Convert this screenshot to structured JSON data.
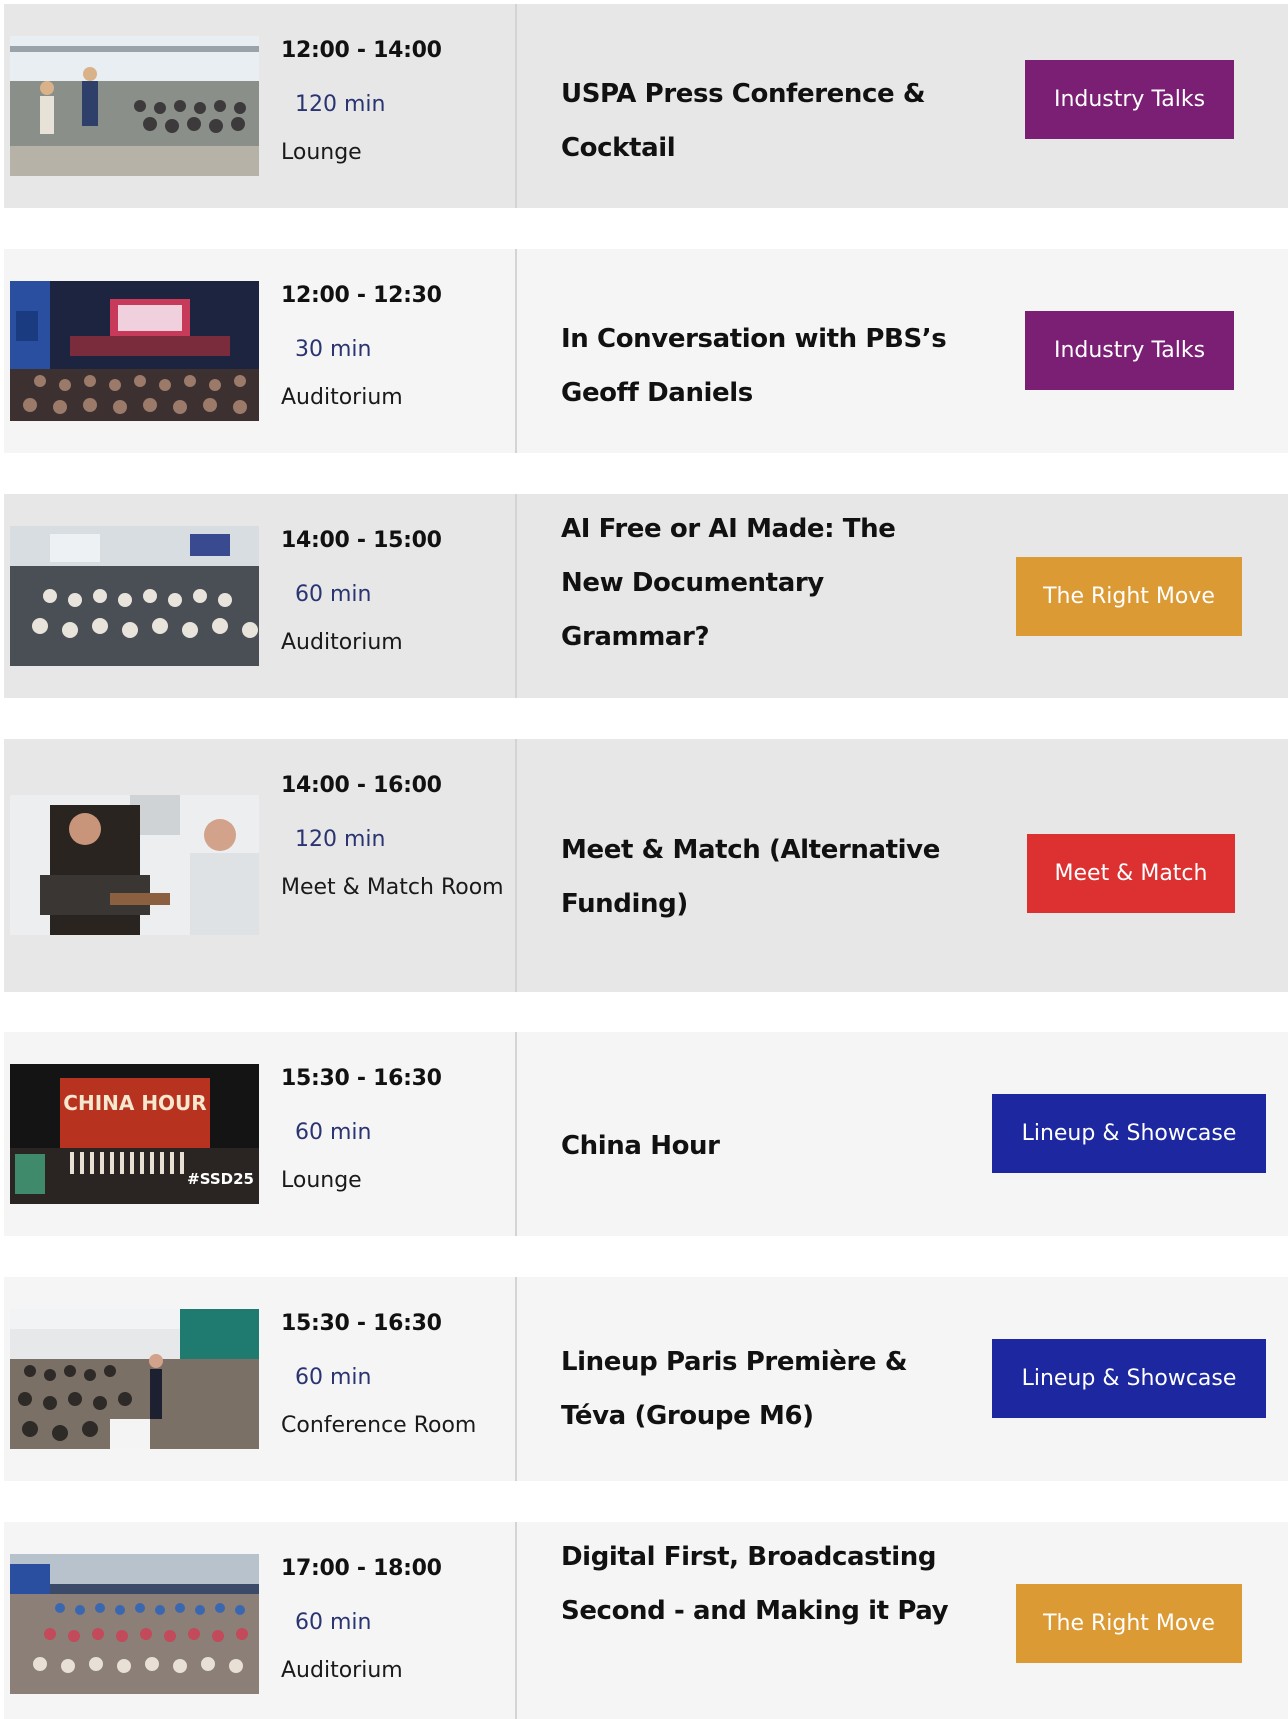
{
  "sessions": [
    {
      "time": "12:00 - 14:00",
      "duration": "120 min",
      "room": "Lounge",
      "title": "USPA Press Conference & Cocktail",
      "category": "Industry Talks",
      "category_color": "#7b1f74"
    },
    {
      "time": "12:00 - 12:30",
      "duration": "30 min",
      "room": "Auditorium",
      "title": "In Conversation with PBS’s Geoff Daniels",
      "category": "Industry Talks",
      "category_color": "#7b1f74"
    },
    {
      "time": "14:00 - 15:00",
      "duration": "60 min",
      "room": "Auditorium",
      "title": "AI Free or AI Made: The New Documentary Grammar?",
      "category": "The Right Move",
      "category_color": "#dc9a35"
    },
    {
      "time": "14:00 - 16:00",
      "duration": "120 min",
      "room": "Meet & Match Room",
      "title": "Meet & Match (Alternative Funding)",
      "category": "Meet & Match",
      "category_color": "#dd3030"
    },
    {
      "time": "15:30 - 16:30",
      "duration": "60 min",
      "room": "Lounge",
      "title": "China Hour",
      "category": "Lineup & Showcase",
      "category_color": "#1c27a0",
      "thumb_text": "CHINA HOUR",
      "thumb_tag": "#SSD25"
    },
    {
      "time": "15:30 - 16:30",
      "duration": "60 min",
      "room": "Conference Room",
      "title": "Lineup Paris Première & Téva (Groupe M6)",
      "category": "Lineup & Showcase",
      "category_color": "#1c27a0"
    },
    {
      "time": "17:00 - 18:00",
      "duration": "60 min",
      "room": "Auditorium",
      "title": "Digital First, Broadcasting Second - and Making it Pay",
      "category": "The Right Move",
      "category_color": "#dc9a35"
    }
  ]
}
